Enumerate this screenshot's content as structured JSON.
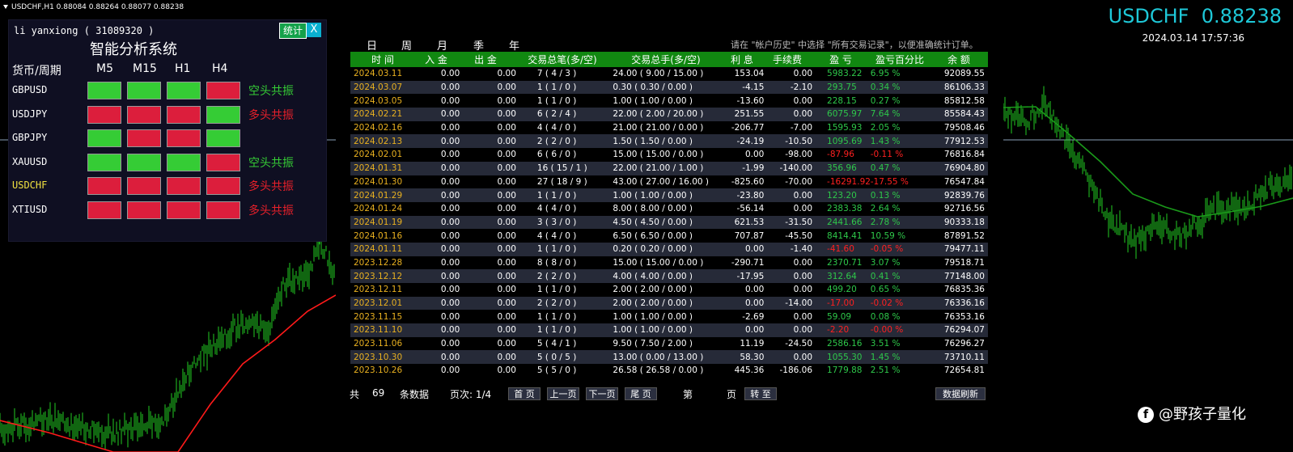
{
  "header": {
    "symbol_line": "USDCHF,H1  0.88084 0.88264 0.88077 0.88238"
  },
  "quote": {
    "symbol": "USDCHF",
    "price": "0.88238",
    "timestamp": "2024.03.14 17:57:36"
  },
  "panel": {
    "user": "li yanxiong ( 31089320 )",
    "title": "智能分析系统",
    "stat_button": "统计",
    "close_button": "X",
    "col_header": [
      "货币/周期",
      "M5",
      "M15",
      "H1",
      "H4"
    ],
    "rows": [
      {
        "symbol": "GBPUSD",
        "cells": [
          "g",
          "g",
          "g",
          "r"
        ],
        "signal": "空头共振",
        "signal_color": "#35cc35",
        "sym_color": "#ffffff"
      },
      {
        "symbol": "USDJPY",
        "cells": [
          "r",
          "r",
          "r",
          "g"
        ],
        "signal": "多头共振",
        "signal_color": "#e8202a",
        "sym_color": "#ffffff"
      },
      {
        "symbol": "GBPJPY",
        "cells": [
          "g",
          "r",
          "r",
          "g"
        ],
        "signal": "",
        "signal_color": "#ffffff",
        "sym_color": "#ffffff"
      },
      {
        "symbol": "XAUUSD",
        "cells": [
          "g",
          "g",
          "g",
          "r"
        ],
        "signal": "空头共振",
        "signal_color": "#35cc35",
        "sym_color": "#ffffff"
      },
      {
        "symbol": "USDCHF",
        "cells": [
          "r",
          "r",
          "r",
          "r"
        ],
        "signal": "多头共振",
        "signal_color": "#e8202a",
        "sym_color": "#f0e040"
      },
      {
        "symbol": "XTIUSD",
        "cells": [
          "r",
          "r",
          "r",
          "r"
        ],
        "signal": "多头共振",
        "signal_color": "#e8202a",
        "sym_color": "#ffffff"
      }
    ]
  },
  "tabs": [
    "日",
    "周",
    "月",
    "季",
    "年"
  ],
  "hint": "请在 \"帐户历史\" 中选择 \"所有交易记录\"，以便准确统计订单。",
  "table": {
    "columns": [
      "时 间",
      "入 金",
      "出 金",
      "交易总笔(多/空)",
      "交易总手(多/空)",
      "利 息",
      "手续费",
      "盈 亏",
      "盈亏百分比",
      "余 额"
    ],
    "rows": [
      [
        "2024.03.11",
        "0.00",
        "0.00",
        "7    ( 4 / 3 )",
        "24.00    ( 9.00 / 15.00 )",
        "153.04",
        "0.00",
        "5983.22",
        "6.95 %",
        "92089.55"
      ],
      [
        "2024.03.07",
        "0.00",
        "0.00",
        "1    ( 1 / 0 )",
        "0.30    ( 0.30 / 0.00 )",
        "-4.15",
        "-2.10",
        "293.75",
        "0.34 %",
        "86106.33"
      ],
      [
        "2024.03.05",
        "0.00",
        "0.00",
        "1    ( 1 / 0 )",
        "1.00    ( 1.00 / 0.00 )",
        "-13.60",
        "0.00",
        "228.15",
        "0.27 %",
        "85812.58"
      ],
      [
        "2024.02.21",
        "0.00",
        "0.00",
        "6    ( 2 / 4 )",
        "22.00    ( 2.00 / 20.00 )",
        "251.55",
        "0.00",
        "6075.97",
        "7.64 %",
        "85584.43"
      ],
      [
        "2024.02.16",
        "0.00",
        "0.00",
        "4    ( 4 / 0 )",
        "21.00    ( 21.00 / 0.00 )",
        "-206.77",
        "-7.00",
        "1595.93",
        "2.05 %",
        "79508.46"
      ],
      [
        "2024.02.13",
        "0.00",
        "0.00",
        "2    ( 2 / 0 )",
        "1.50    ( 1.50 / 0.00 )",
        "-24.19",
        "-10.50",
        "1095.69",
        "1.43 %",
        "77912.53"
      ],
      [
        "2024.02.01",
        "0.00",
        "0.00",
        "6    ( 6 / 0 )",
        "15.00    ( 15.00 / 0.00 )",
        "0.00",
        "-98.00",
        "-87.96",
        "-0.11 %",
        "76816.84"
      ],
      [
        "2024.01.31",
        "0.00",
        "0.00",
        "16    ( 15 / 1 )",
        "22.00    ( 21.00 / 1.00 )",
        "-1.99",
        "-140.00",
        "356.96",
        "0.47 %",
        "76904.80"
      ],
      [
        "2024.01.30",
        "0.00",
        "0.00",
        "27    ( 18 / 9 )",
        "43.00    ( 27.00 / 16.00 )",
        "-825.60",
        "-70.00",
        "-16291.92",
        "-17.55 %",
        "76547.84"
      ],
      [
        "2024.01.29",
        "0.00",
        "0.00",
        "1    ( 1 / 0 )",
        "1.00    ( 1.00 / 0.00 )",
        "-23.80",
        "0.00",
        "123.20",
        "0.13 %",
        "92839.76"
      ],
      [
        "2024.01.24",
        "0.00",
        "0.00",
        "4    ( 4 / 0 )",
        "8.00    ( 8.00 / 0.00 )",
        "-56.14",
        "0.00",
        "2383.38",
        "2.64 %",
        "92716.56"
      ],
      [
        "2024.01.19",
        "0.00",
        "0.00",
        "3    ( 3 / 0 )",
        "4.50    ( 4.50 / 0.00 )",
        "621.53",
        "-31.50",
        "2441.66",
        "2.78 %",
        "90333.18"
      ],
      [
        "2024.01.16",
        "0.00",
        "0.00",
        "4    ( 4 / 0 )",
        "6.50    ( 6.50 / 0.00 )",
        "707.87",
        "-45.50",
        "8414.41",
        "10.59 %",
        "87891.52"
      ],
      [
        "2024.01.11",
        "0.00",
        "0.00",
        "1    ( 1 / 0 )",
        "0.20    ( 0.20 / 0.00 )",
        "0.00",
        "-1.40",
        "-41.60",
        "-0.05 %",
        "79477.11"
      ],
      [
        "2023.12.28",
        "0.00",
        "0.00",
        "8    ( 8 / 0 )",
        "15.00    ( 15.00 / 0.00 )",
        "-290.71",
        "0.00",
        "2370.71",
        "3.07 %",
        "79518.71"
      ],
      [
        "2023.12.12",
        "0.00",
        "0.00",
        "2    ( 2 / 0 )",
        "4.00    ( 4.00 / 0.00 )",
        "-17.95",
        "0.00",
        "312.64",
        "0.41 %",
        "77148.00"
      ],
      [
        "2023.12.11",
        "0.00",
        "0.00",
        "1    ( 1 / 0 )",
        "2.00    ( 2.00 / 0.00 )",
        "0.00",
        "0.00",
        "499.20",
        "0.65 %",
        "76835.36"
      ],
      [
        "2023.12.01",
        "0.00",
        "0.00",
        "2    ( 2 / 0 )",
        "2.00    ( 2.00 / 0.00 )",
        "0.00",
        "-14.00",
        "-17.00",
        "-0.02 %",
        "76336.16"
      ],
      [
        "2023.11.15",
        "0.00",
        "0.00",
        "1    ( 1 / 0 )",
        "1.00    ( 1.00 / 0.00 )",
        "-2.69",
        "0.00",
        "59.09",
        "0.08 %",
        "76353.16"
      ],
      [
        "2023.11.10",
        "0.00",
        "0.00",
        "1    ( 1 / 0 )",
        "1.00    ( 1.00 / 0.00 )",
        "0.00",
        "0.00",
        "-2.20",
        "-0.00 %",
        "76294.07"
      ],
      [
        "2023.11.06",
        "0.00",
        "0.00",
        "5    ( 4 / 1 )",
        "9.50    ( 7.50 / 2.00 )",
        "11.19",
        "-24.50",
        "2586.16",
        "3.51 %",
        "76296.27"
      ],
      [
        "2023.10.30",
        "0.00",
        "0.00",
        "5    ( 0 / 5 )",
        "13.00    ( 0.00 / 13.00 )",
        "58.30",
        "0.00",
        "1055.30",
        "1.45 %",
        "73710.11"
      ],
      [
        "2023.10.26",
        "0.00",
        "0.00",
        "5    ( 5 / 0 )",
        "26.58    ( 26.58 / 0.00 )",
        "445.36",
        "-186.06",
        "1779.88",
        "2.51 %",
        "72654.81"
      ]
    ]
  },
  "pager": {
    "total_prefix": "共",
    "total": "69",
    "total_suffix": "条数据",
    "page_info": "页次: 1/4",
    "first": "首 页",
    "prev": "上一页",
    "next": "下一页",
    "last": "尾 页",
    "goto_prefix": "第",
    "goto_suffix": "页",
    "goto_button": "转 至",
    "refresh": "数据刷新"
  },
  "brand": {
    "text": "@野孩子量化"
  },
  "colors": {
    "date": "#e8b020",
    "profit": "#2ec84a",
    "loss": "#ff2020",
    "accent": "#1ec8d8"
  }
}
